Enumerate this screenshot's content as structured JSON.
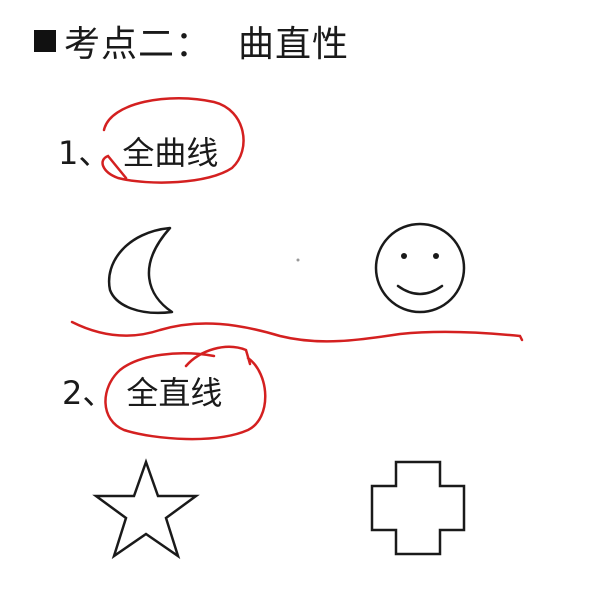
{
  "heading": {
    "bullet": "■",
    "prefix": "考点二：",
    "topic": "曲直性"
  },
  "items": [
    {
      "number": "1、",
      "label": "全曲线",
      "shapes": [
        "crescent-moon",
        "smiley-face"
      ]
    },
    {
      "number": "2、",
      "label": "全直线",
      "shapes": [
        "star",
        "cross"
      ]
    }
  ],
  "colors": {
    "ink": "#1a1a1a",
    "annotation": "#d42020"
  }
}
